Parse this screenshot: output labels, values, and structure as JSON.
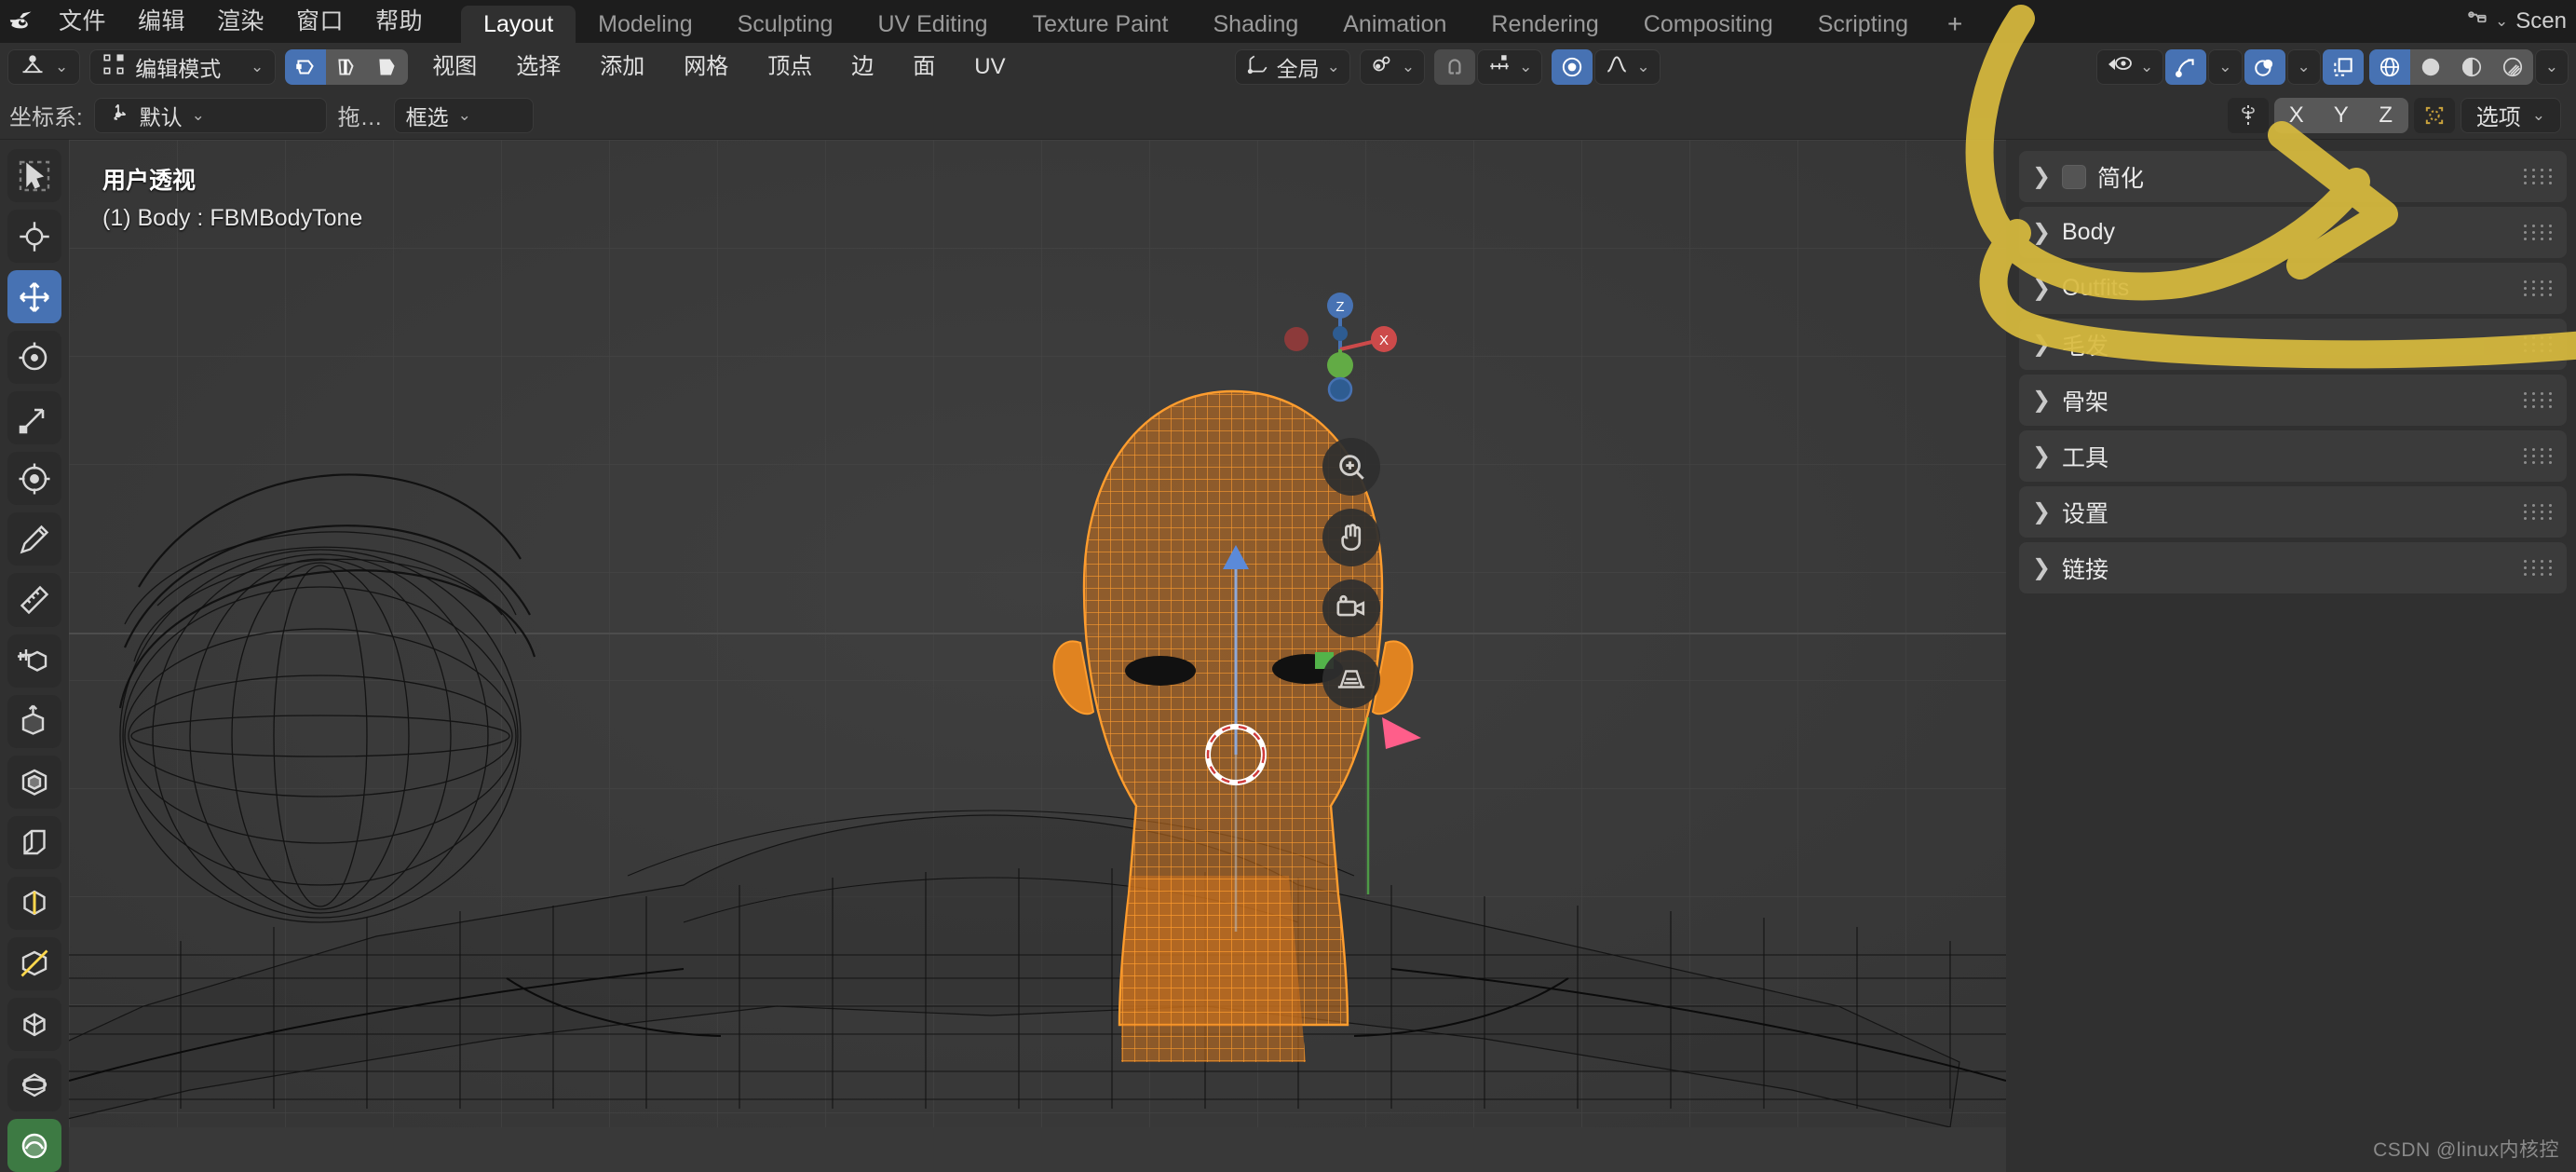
{
  "app": {
    "logo_icon": "blender-logo-icon",
    "menus": [
      "文件",
      "编辑",
      "渲染",
      "窗口",
      "帮助"
    ],
    "workspace_tabs": [
      {
        "label": "Layout",
        "active": true
      },
      {
        "label": "Modeling",
        "active": false
      },
      {
        "label": "Sculpting",
        "active": false
      },
      {
        "label": "UV Editing",
        "active": false
      },
      {
        "label": "Texture Paint",
        "active": false
      },
      {
        "label": "Shading",
        "active": false
      },
      {
        "label": "Animation",
        "active": false
      },
      {
        "label": "Rendering",
        "active": false
      },
      {
        "label": "Compositing",
        "active": false
      },
      {
        "label": "Scripting",
        "active": false
      },
      {
        "label": "+",
        "active": false
      }
    ],
    "scene_label": "Scen"
  },
  "header": {
    "editor_type_icon": "editor-type-icon",
    "mode": "编辑模式",
    "mesh_select_modes": [
      {
        "name": "vertex-select-mode",
        "active": true
      },
      {
        "name": "edge-select-mode",
        "active": false
      },
      {
        "name": "face-select-mode",
        "active": false
      }
    ],
    "menus": [
      "视图",
      "选择",
      "添加",
      "网格",
      "顶点",
      "边",
      "面",
      "UV"
    ],
    "transform_orientation": "全局",
    "proportional_icon": "proportional-edit-icon",
    "snap_magnet_icon": "snap-magnet-icon",
    "snap_to_icon": "snap-increment-icon",
    "proportional_on_icon": "proportional-on-icon",
    "falloff_icon": "falloff-curve-icon",
    "right_icons": [
      {
        "name": "visibility-icon",
        "active": false,
        "has_chevron": true
      },
      {
        "name": "gizmo-icon",
        "active": true,
        "has_chevron": true
      },
      {
        "name": "overlays-icon",
        "active": true,
        "has_chevron": true
      },
      {
        "name": "xray-toggle-icon",
        "active": true,
        "has_chevron": false
      },
      {
        "name": "shading-wireframe-icon",
        "active": true,
        "has_chevron": false
      },
      {
        "name": "shading-solid-icon",
        "active": false,
        "has_chevron": false
      },
      {
        "name": "shading-material-icon",
        "active": false,
        "has_chevron": false
      },
      {
        "name": "shading-rendered-icon",
        "active": false,
        "has_chevron": true
      }
    ]
  },
  "toolsettings": {
    "orientation_label": "坐标系:",
    "orientation_value": "默认",
    "drag_label": "拖…",
    "drag_value": "框选",
    "mirror_icon": "mirror-icon",
    "axes": [
      "X",
      "Y",
      "Z"
    ],
    "snap_target_icon": "snap-target-icon",
    "options_label": "选项"
  },
  "toolbar": {
    "tools": [
      {
        "name": "tweak-tool",
        "icon": "cursor-select-icon",
        "active": false
      },
      {
        "name": "cursor-tool",
        "icon": "3d-cursor-icon",
        "active": false
      },
      {
        "name": "move-tool",
        "icon": "move-arrows-icon",
        "active": true
      },
      {
        "name": "rotate-tool",
        "icon": "rotate-icon",
        "active": false
      },
      {
        "name": "scale-tool",
        "icon": "scale-icon",
        "active": false
      },
      {
        "name": "transform-tool",
        "icon": "transform-icon",
        "active": false
      },
      {
        "name": "annotate-tool",
        "icon": "pencil-icon",
        "active": false
      },
      {
        "name": "measure-tool",
        "icon": "ruler-icon",
        "active": false
      },
      {
        "name": "add-cube-tool",
        "icon": "add-cube-icon",
        "active": false
      },
      {
        "name": "extrude-tool",
        "icon": "extrude-region-icon",
        "active": false
      },
      {
        "name": "inset-faces-tool",
        "icon": "inset-faces-icon",
        "active": false
      },
      {
        "name": "bevel-tool",
        "icon": "bevel-icon",
        "active": false
      },
      {
        "name": "loop-cut-tool",
        "icon": "loop-cut-icon",
        "active": false
      },
      {
        "name": "knife-tool",
        "icon": "knife-icon",
        "active": false
      },
      {
        "name": "poly-build-tool",
        "icon": "poly-build-icon",
        "active": false
      },
      {
        "name": "spin-tool",
        "icon": "spin-icon",
        "active": false
      },
      {
        "name": "smooth-tool",
        "icon": "smooth-icon",
        "active": true
      }
    ]
  },
  "viewport": {
    "view_label": "用户透视",
    "object_label": "(1) Body : FBMBodyTone",
    "gizmo_axes": [
      {
        "label": "Z",
        "color": "#4772b3"
      },
      {
        "label": "X",
        "color": "#cc4a4a"
      },
      {
        "label": "Y",
        "color": "#62ab45"
      }
    ],
    "nav_buttons": [
      {
        "name": "zoom-view-button",
        "icon": "magnifier-icon"
      },
      {
        "name": "pan-view-button",
        "icon": "hand-icon"
      },
      {
        "name": "camera-view-button",
        "icon": "camera-icon"
      },
      {
        "name": "toggle-perspective-button",
        "icon": "grid-perspective-icon"
      }
    ],
    "colors": {
      "background": "#393939",
      "selection": "#ff9d2e",
      "wire": "#1b1b1b",
      "cursor": "#ffffff"
    }
  },
  "properties_panel": {
    "items": [
      {
        "label": "简化",
        "has_checkbox": true,
        "checked": false,
        "expanded": false
      },
      {
        "label": "Body",
        "has_checkbox": false,
        "checked": false,
        "expanded": false
      },
      {
        "label": "Outfits",
        "has_checkbox": false,
        "checked": false,
        "expanded": false
      },
      {
        "label": "毛发",
        "has_checkbox": false,
        "checked": false,
        "expanded": false
      },
      {
        "label": "骨架",
        "has_checkbox": false,
        "checked": false,
        "expanded": false
      },
      {
        "label": "工具",
        "has_checkbox": false,
        "checked": false,
        "expanded": false
      },
      {
        "label": "设置",
        "has_checkbox": false,
        "checked": false,
        "expanded": false
      },
      {
        "label": "链接",
        "has_checkbox": false,
        "checked": false,
        "expanded": false
      }
    ]
  },
  "annotation": {
    "color": "#d6b93c",
    "description": "yellow-marker-arrow"
  },
  "watermark": "CSDN @linux内核控"
}
